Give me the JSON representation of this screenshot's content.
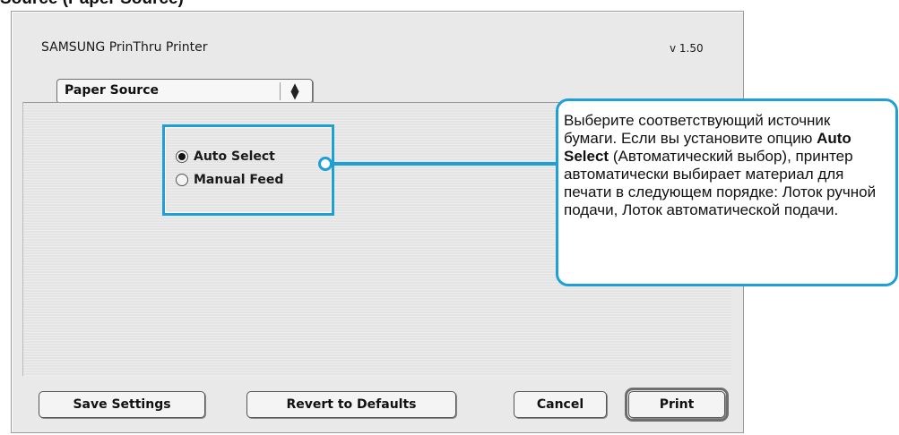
{
  "top_fragment": "Source (Paper Source)",
  "dialog": {
    "title": "SAMSUNG PrinThru Printer",
    "version": "v 1.50"
  },
  "panel_popup": {
    "selected": "Paper Source"
  },
  "paper_source": {
    "options": [
      {
        "label": "Auto Select",
        "selected": true
      },
      {
        "label": "Manual Feed",
        "selected": false
      }
    ]
  },
  "callout": {
    "text_part1": "Выберите соответствующий источник бумаги. Если вы установите опцию ",
    "bold": "Auto Select",
    "text_part2": " (Автоматический выбор), принтер автоматически выбирает материал для печати в следующем порядке: Лоток ручной подачи, Лоток автоматической подачи."
  },
  "buttons": {
    "save_settings": "Save Settings",
    "revert_to_defaults": "Revert to Defaults",
    "cancel": "Cancel",
    "print": "Print"
  },
  "colors": {
    "highlight": "#1e9fd6"
  }
}
